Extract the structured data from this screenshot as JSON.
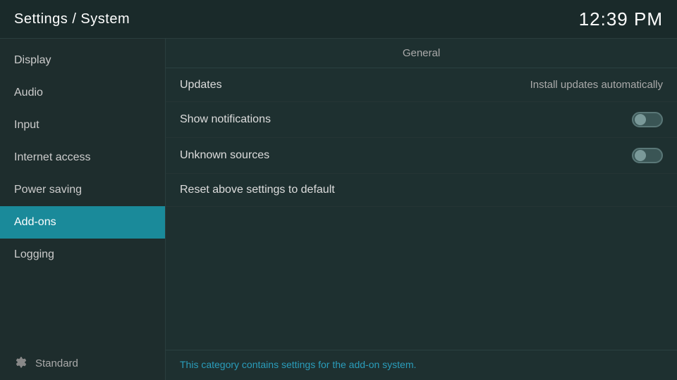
{
  "header": {
    "title": "Settings / System",
    "time": "12:39 PM"
  },
  "sidebar": {
    "items": [
      {
        "id": "display",
        "label": "Display",
        "active": false
      },
      {
        "id": "audio",
        "label": "Audio",
        "active": false
      },
      {
        "id": "input",
        "label": "Input",
        "active": false
      },
      {
        "id": "internet-access",
        "label": "Internet access",
        "active": false
      },
      {
        "id": "power-saving",
        "label": "Power saving",
        "active": false
      },
      {
        "id": "add-ons",
        "label": "Add-ons",
        "active": true
      },
      {
        "id": "logging",
        "label": "Logging",
        "active": false
      }
    ],
    "footer_label": "Standard"
  },
  "content": {
    "section_header": "General",
    "settings": [
      {
        "id": "updates",
        "label": "Updates",
        "value": "Install updates automatically",
        "type": "value"
      },
      {
        "id": "show-notifications",
        "label": "Show notifications",
        "value": "",
        "type": "toggle",
        "enabled": false
      },
      {
        "id": "unknown-sources",
        "label": "Unknown sources",
        "value": "",
        "type": "toggle",
        "enabled": false
      },
      {
        "id": "reset-settings",
        "label": "Reset above settings to default",
        "type": "reset"
      }
    ],
    "footer_text": "This category contains settings for the add-on system."
  }
}
